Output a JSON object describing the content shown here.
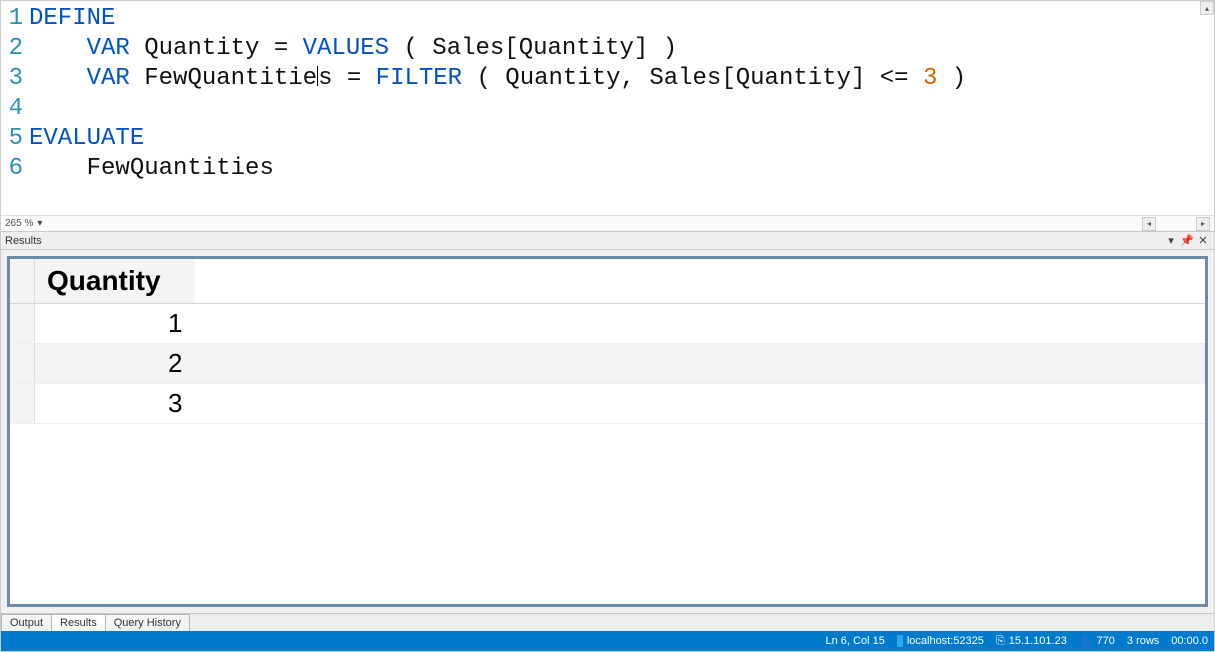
{
  "editor": {
    "zoom": "265 %",
    "lines": [
      {
        "n": "1",
        "tokens": [
          {
            "t": "DEFINE",
            "c": "kw1"
          }
        ]
      },
      {
        "n": "2",
        "tokens": [
          {
            "t": "    ",
            "c": ""
          },
          {
            "t": "VAR",
            "c": "kw2"
          },
          {
            "t": " Quantity = ",
            "c": "ident"
          },
          {
            "t": "VALUES",
            "c": "fn"
          },
          {
            "t": " ( Sales[Quantity] )",
            "c": "ident"
          }
        ]
      },
      {
        "n": "3",
        "tokens": [
          {
            "t": "    ",
            "c": ""
          },
          {
            "t": "VAR",
            "c": "kw2"
          },
          {
            "t": " FewQuantitie",
            "c": "ident"
          },
          {
            "t": "__CURSOR__",
            "c": ""
          },
          {
            "t": "s = ",
            "c": "ident"
          },
          {
            "t": "FILTER",
            "c": "fn"
          },
          {
            "t": " ( Quantity, Sales[Quantity] <= ",
            "c": "ident"
          },
          {
            "t": "3",
            "c": "num"
          },
          {
            "t": " )",
            "c": "ident"
          }
        ]
      },
      {
        "n": "4",
        "tokens": []
      },
      {
        "n": "5",
        "tokens": [
          {
            "t": "EVALUATE",
            "c": "kw1"
          }
        ]
      },
      {
        "n": "6",
        "tokens": [
          {
            "t": "    FewQuantities",
            "c": "ident"
          }
        ]
      }
    ]
  },
  "resultsPanel": {
    "title": "Results"
  },
  "grid": {
    "column": "Quantity",
    "rows": [
      "1",
      "2",
      "3"
    ]
  },
  "bottomTabs": {
    "output": "Output",
    "results": "Results",
    "history": "Query History"
  },
  "status": {
    "cursor": "Ln 6, Col 15",
    "server": "localhost:52325",
    "version": "15.1.101.23",
    "user": "770",
    "rows": "3 rows",
    "time": "00:00.0"
  }
}
